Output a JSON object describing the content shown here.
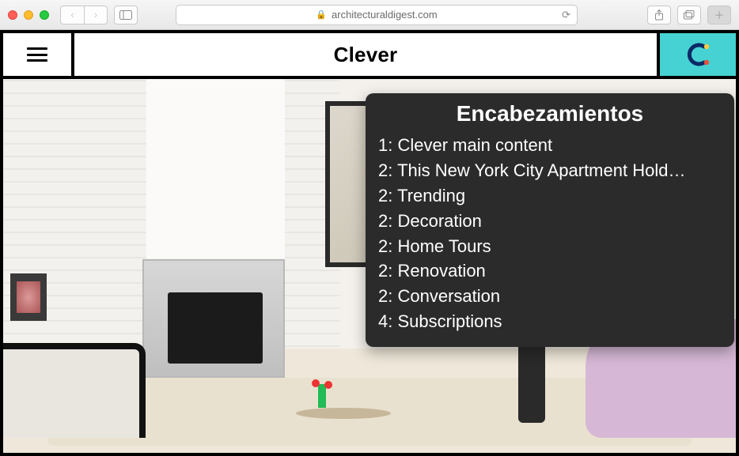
{
  "browser": {
    "domain": "architecturaldigest.com"
  },
  "site": {
    "brand": "Clever"
  },
  "rotor": {
    "title": "Encabezamientos",
    "items": [
      {
        "level": "1",
        "label": "Clever main content"
      },
      {
        "level": "2",
        "label": "This New York City Apartment Hold…"
      },
      {
        "level": "2",
        "label": "Trending"
      },
      {
        "level": "2",
        "label": "Decoration"
      },
      {
        "level": "2",
        "label": "Home Tours"
      },
      {
        "level": "2",
        "label": "Renovation"
      },
      {
        "level": "2",
        "label": "Conversation"
      },
      {
        "level": "4",
        "label": "Subscriptions"
      }
    ]
  }
}
